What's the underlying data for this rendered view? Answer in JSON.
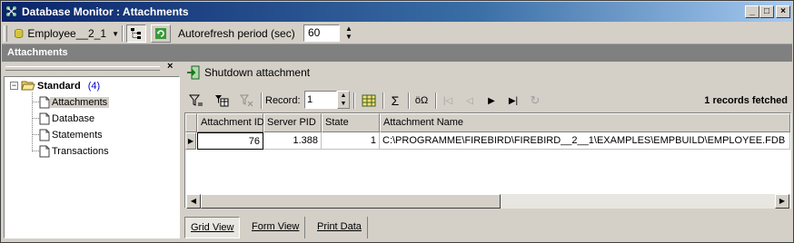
{
  "window": {
    "title": "Database Monitor : Attachments",
    "controls": {
      "minimize": "_",
      "maximize": "□",
      "close": "×"
    }
  },
  "toolbar": {
    "database_name": "Employee__2_1",
    "autorefresh_label": "Autorefresh period  (sec)",
    "autorefresh_value": "60"
  },
  "section_header": "Attachments",
  "left_panel": {
    "close_glyph": "×",
    "tree": {
      "root_label": "Standard",
      "root_count": "(4)",
      "items": [
        "Attachments",
        "Database",
        "Statements",
        "Transactions"
      ]
    }
  },
  "actions": {
    "shutdown_label": "Shutdown attachment"
  },
  "grid_toolbar": {
    "record_label": "Record:",
    "record_value": "1",
    "fetched_text": "1 records fetched"
  },
  "grid": {
    "columns": [
      "Attachment ID",
      "Server PID",
      "State",
      "Attachment Name"
    ],
    "rows": [
      [
        "76",
        "1.388",
        "1",
        "C:\\PROGRAMME\\FIREBIRD\\FIREBIRD__2__1\\EXAMPLES\\EMPBUILD\\EMPLOYEE.FDB"
      ]
    ]
  },
  "tabs": [
    "Grid View",
    "Form View",
    "Print Data"
  ],
  "colors": {
    "title_bar": "#0a246a",
    "band": "#808080",
    "face": "#d4d0c8",
    "count": "#0000cc"
  }
}
